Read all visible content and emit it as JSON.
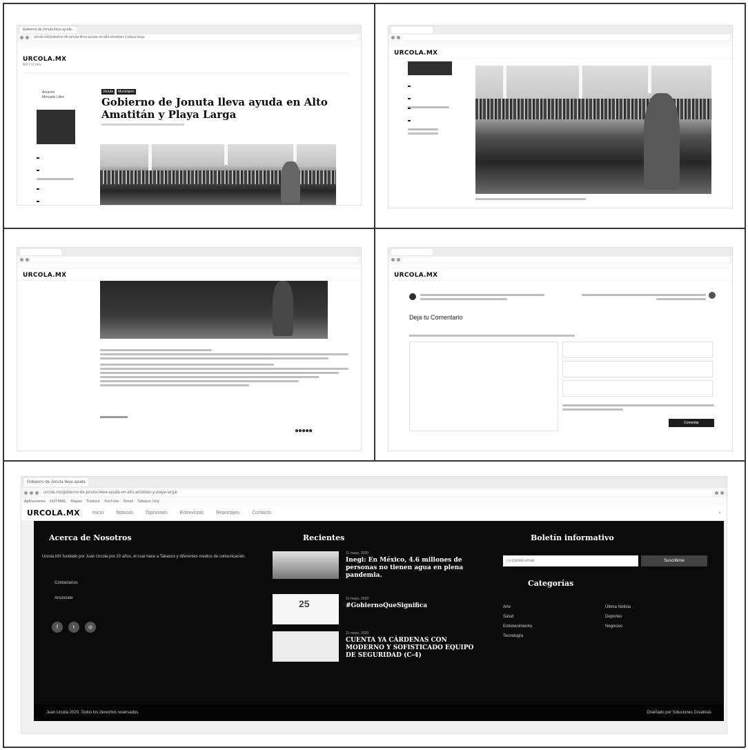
{
  "panel1": {
    "tab_title": "Gobierno de Jonuta lleva ayuda...",
    "url": "urcola.mx/gobierno-de-jonuta-lleva-ayuda-en-alto-amatitan-y-playa-larga",
    "logo": "URCOLA.MX",
    "logo_sub": "NOTICIAS",
    "tags": [
      "Jonuta",
      "Municipios"
    ],
    "headline": "Gobierno de Jonuta lleva ayuda en Alto Amatitán y Playa Larga",
    "side_links": [
      "Amazon",
      "Mercado Libre"
    ]
  },
  "panel2": {
    "logo": "URCOLA.MX"
  },
  "panel3": {
    "logo": "URCOLA.MX"
  },
  "panel4": {
    "logo": "URCOLA.MX",
    "comment_heading": "Deja tu Comentario",
    "submit_label": "Comentar"
  },
  "panel5": {
    "tab_title": "Gobierno de Jonuta lleva ayuda",
    "url": "urcola.mx/gobierno-de-jonuta-lleva-ayuda-en-alto-amatitan-y-playa-larga/",
    "bookmarks": [
      "Aplicaciones",
      "HOTMAIL",
      "Mapas",
      "Traducir",
      "YouTube",
      "Gmail",
      "Tabasco Hoy"
    ],
    "logo": "URCOLA.MX",
    "nav": [
      "Inicio",
      "Noticias",
      "Opiniones",
      "Entrevistas",
      "Reportajes",
      "Contacto"
    ],
    "about": {
      "title": "Acerca de Nosotros",
      "text": "Urcola.MX fundado por Juan Urcola por 20 años, el cual hace a Tabasco y diferentes medios de comunicación.",
      "links": [
        "Contactanos",
        "Anunciate"
      ]
    },
    "recent": {
      "title": "Recientes",
      "items": [
        {
          "date": "31 mayo, 2020",
          "title": "Inegi: En México, 4.6 millones de personas no tienen agua en plena pandemia."
        },
        {
          "date": "31 mayo, 2020",
          "title": "#GobiernoQueSignifica"
        },
        {
          "date": "31 mayo, 2020",
          "title": "CUENTA YA CÁRDENAS CON MODERNO Y SOFISTICADO EQUIPO DE SEGURIDAD (C-4)"
        }
      ],
      "thumb2_number": "25"
    },
    "newsletter": {
      "title": "Boletín informativo",
      "placeholder": "Tu correo email",
      "button": "Suscribirse"
    },
    "categories": {
      "title": "Categorías",
      "left": [
        "Arte",
        "Salud",
        "Entretenimiento",
        "Tecnología"
      ],
      "right": [
        "Última Noticia",
        "Deportes",
        "Negocios"
      ]
    },
    "copyright": "Juan Urcola 2020. Todos los derechos reservados.",
    "credit": "Diseñado por Soluciones Creativas"
  },
  "colors": {
    "footer_bg": "#111111",
    "accent": "#222222"
  }
}
